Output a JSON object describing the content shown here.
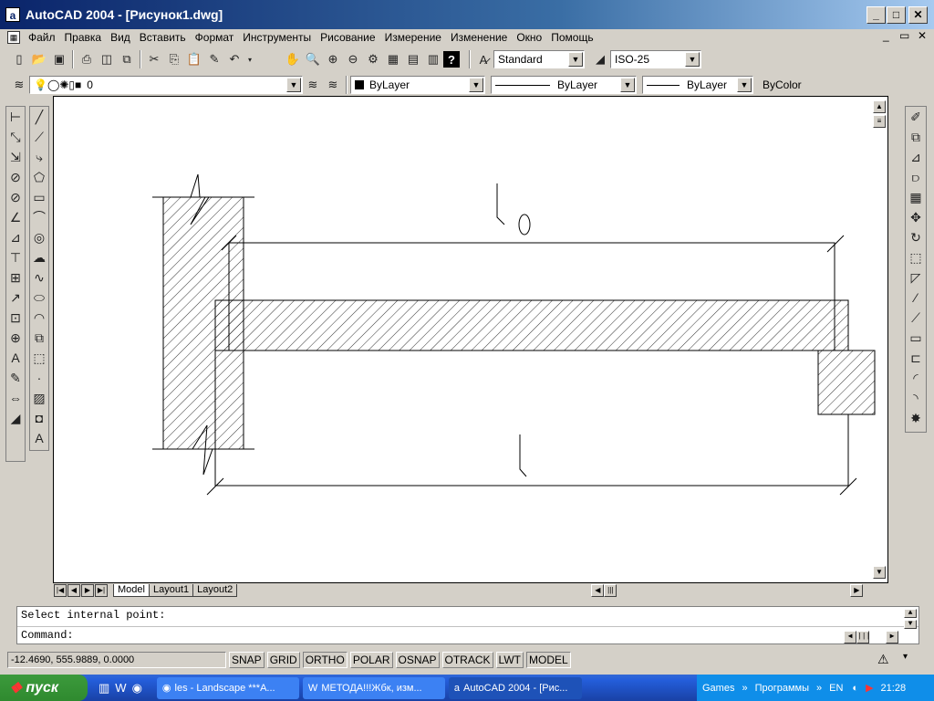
{
  "window": {
    "title": "AutoCAD 2004 - [Рисунок1.dwg]"
  },
  "menu": [
    "Файл",
    "Правка",
    "Вид",
    "Вставить",
    "Формат",
    "Инструменты",
    "Рисование",
    "Измерение",
    "Изменение",
    "Окно",
    "Помощь"
  ],
  "toolbar1": {
    "text_style": "Standard",
    "dim_style": "ISO-25"
  },
  "toolbar2": {
    "layer": "0",
    "color": "ByLayer",
    "linetype": "ByLayer",
    "lineweight": "ByLayer",
    "plotstyle": "ByColor"
  },
  "tabs": [
    "Model",
    "Layout1",
    "Layout2"
  ],
  "command": {
    "line1": "Select internal point:",
    "line2": "Command:"
  },
  "status": {
    "coords": "-12.4690, 555.9889, 0.0000",
    "buttons": [
      "SNAP",
      "GRID",
      "ORTHO",
      "POLAR",
      "OSNAP",
      "OTRACK",
      "LWT",
      "MODEL"
    ]
  },
  "taskbar": {
    "start": "пуск",
    "tasks": [
      "les - Landscape ***A...",
      "МЕТОДА!!!Жбк, изм...",
      "AutoCAD 2004 - [Рис..."
    ],
    "tray_items": [
      "Games",
      "Программы",
      "EN"
    ],
    "clock": "21:28"
  },
  "drawing": {
    "label": "0"
  }
}
